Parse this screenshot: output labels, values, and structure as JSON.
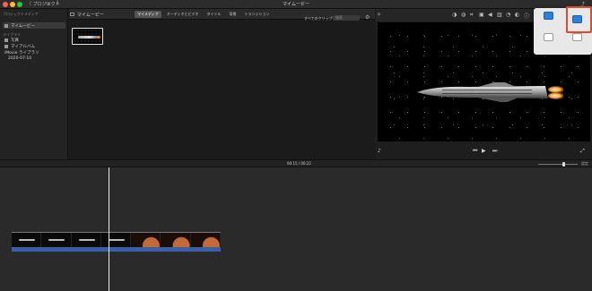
{
  "titlebar": {
    "projects_label": "〈 プロジェクト",
    "app_title": "マイムービー",
    "icons": [
      "folder-icon",
      "share-icon",
      "enhance-icon"
    ]
  },
  "sidebar": {
    "section_project_media": "プロジェクトメディア",
    "project_item": "マイムービー",
    "section_libraries": "ライブラリ",
    "items": [
      "写真",
      "マイアルバム",
      "iMovie ライブラリ",
      "2020-07-10"
    ]
  },
  "browser": {
    "title": "マイムービー",
    "tabs": [
      "マイメディア",
      "オーディオとビデオ",
      "タイトル",
      "背景",
      "トランジション"
    ],
    "active_tab": 0,
    "filter_label": "すべてのクリップ ≎",
    "search_placeholder": "検索"
  },
  "viewer": {
    "toolbar_icons": [
      "color-balance-icon",
      "color-correction-icon",
      "crop-icon",
      "stabilization-icon",
      "volume-icon",
      "noise-reduction-icon",
      "speed-icon",
      "filter-icon",
      "info-icon"
    ],
    "transport_icons": [
      "skip-back-icon",
      "play-icon",
      "skip-forward-icon"
    ]
  },
  "popover": {
    "items": [
      {
        "label": "",
        "icon": "picture-in-picture-icon"
      },
      {
        "label": "",
        "icon": "side-by-side-icon"
      },
      {
        "label": "",
        "icon": "cutaway-icon"
      },
      {
        "label": "",
        "icon": "green-screen-icon"
      }
    ]
  },
  "timeline": {
    "timecode": "00:15 / 00:22",
    "settings_label": "設定",
    "zoom_level": 0.64
  },
  "colors": {
    "highlight": "#e04a2a",
    "accent_blue": "#2e7fd6",
    "audio_track": "#3a5fa8"
  }
}
